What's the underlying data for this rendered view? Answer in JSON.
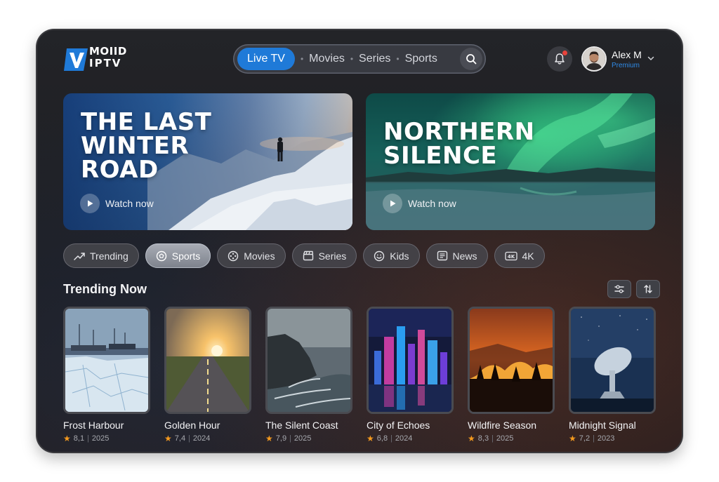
{
  "brand": {
    "logo_line1": "MOIID",
    "logo_line2": "IPTV",
    "accent": "#1f7ad8"
  },
  "nav": {
    "active": "Live TV",
    "items": [
      "Movies",
      "Series",
      "Sports"
    ],
    "search_icon": "search-icon"
  },
  "header": {
    "bell_icon": "bell-icon",
    "user_name": "Alex M",
    "user_plan": "Premium"
  },
  "hero": [
    {
      "title": "THE LAST\nWINTER\nROAD",
      "cta": "Watch now"
    },
    {
      "title": "NORTHERN\nSILENCE",
      "cta": "Watch now"
    }
  ],
  "chips": [
    {
      "label": "Trending",
      "icon": "trending-icon",
      "active": false
    },
    {
      "label": "Sports",
      "icon": "ball-icon",
      "active": true
    },
    {
      "label": "Movies",
      "icon": "film-reel-icon",
      "active": false
    },
    {
      "label": "Series",
      "icon": "clapperboard-icon",
      "active": false
    },
    {
      "label": "Kids",
      "icon": "smiley-icon",
      "active": false
    },
    {
      "label": "News",
      "icon": "newspaper-icon",
      "active": false
    },
    {
      "label": "4K",
      "icon": "4k-icon",
      "active": false
    }
  ],
  "trending": {
    "title": "Trending Now",
    "filter_icon": "filter-icon",
    "sort_icon": "sort-icon",
    "items": [
      {
        "title": "Frost Harbour",
        "rating": "8,1",
        "year": "2025"
      },
      {
        "title": "Golden Hour",
        "rating": "7,4",
        "year": "2024"
      },
      {
        "title": "The Silent Coast",
        "rating": "7,9",
        "year": "2025"
      },
      {
        "title": "City of Echoes",
        "rating": "6,8",
        "year": "2024"
      },
      {
        "title": "Wildfire Season",
        "rating": "8,3",
        "year": "2025"
      },
      {
        "title": "Midnight Signal",
        "rating": "7,2",
        "year": "2023"
      }
    ]
  }
}
